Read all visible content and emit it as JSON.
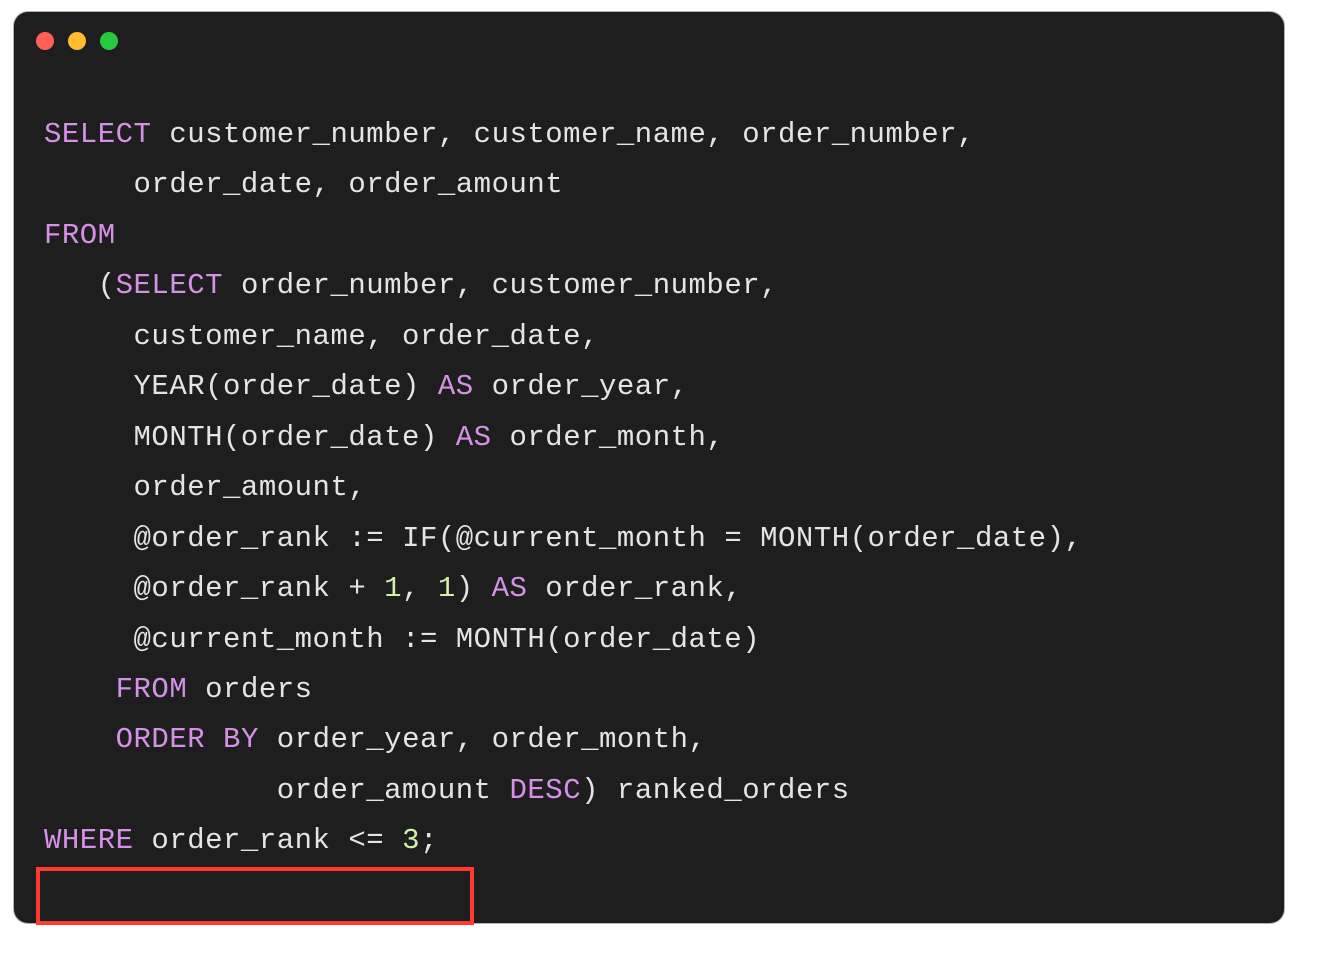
{
  "code": {
    "line1_kw": "SELECT",
    "line1_rest": " customer_number, customer_name, order_number,",
    "line2": "     order_date, order_amount",
    "line3_kw": "FROM",
    "line4_open": "   (",
    "line4_kw": "SELECT",
    "line4_rest": " order_number, customer_number,",
    "line5": "     customer_name, order_date, ",
    "line6_pre": "     YEAR(order_date) ",
    "line6_kw": "AS",
    "line6_post": " order_year,",
    "line7_pre": "     MONTH(order_date) ",
    "line7_kw": "AS",
    "line7_post": " order_month,",
    "line8": "     order_amount,",
    "line9_pre": "     @order_rank := ",
    "line9_if": "IF",
    "line9_post": "(@current_month = MONTH(order_date),",
    "line10_pre": "     @order_rank + ",
    "line10_n1": "1",
    "line10_mid": ", ",
    "line10_n2": "1",
    "line10_mid2": ") ",
    "line10_kw": "AS",
    "line10_post": " order_rank,",
    "line11": "     @current_month := MONTH(order_date)",
    "line12_indent": "    ",
    "line12_kw": "FROM",
    "line12_post": " orders",
    "line13_indent": "    ",
    "line13_kw": "ORDER BY",
    "line13_post": " order_year, order_month,",
    "line14_pre": "             order_amount ",
    "line14_kw": "DESC",
    "line14_post": ") ranked_orders",
    "line15_kw": "WHERE",
    "line15_mid": " order_rank <= ",
    "line15_num": "3",
    "line15_end": ";"
  }
}
